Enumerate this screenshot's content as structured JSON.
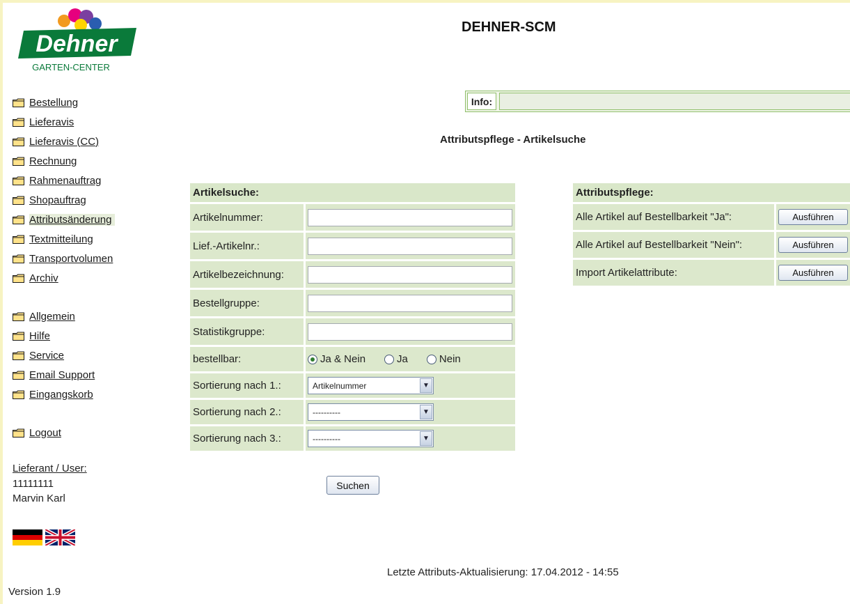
{
  "logo": {
    "brand": "Dehner",
    "subtitle": "GARTEN-CENTER"
  },
  "header": {
    "title": "DEHNER-SCM"
  },
  "nav": {
    "main": [
      "Bestellung",
      "Lieferavis",
      "Lieferavis (CC)",
      "Rechnung",
      "Rahmenauftrag",
      "Shopauftrag",
      "Attributsänderung",
      "Textmitteilung",
      "Transportvolumen",
      "Archiv"
    ],
    "secondary": [
      "Allgemein",
      "Hilfe",
      "Service",
      "Email Support",
      "Eingangskorb"
    ],
    "logout": "Logout",
    "active": "Attributsänderung"
  },
  "user": {
    "label": "Lieferant / User:",
    "id": "11111111",
    "name": "Marvin Karl"
  },
  "languages": [
    "de-flag-icon",
    "uk-flag-icon"
  ],
  "info": {
    "label": "Info:",
    "value": ""
  },
  "page": {
    "title": "Attributspflege - Artikelsuche"
  },
  "search": {
    "header": "Artikelsuche:",
    "fields": [
      {
        "label": "Artikelnummer:",
        "value": ""
      },
      {
        "label": "Lief.-Artikelnr.:",
        "value": ""
      },
      {
        "label": "Artikelbezeichnung:",
        "value": ""
      },
      {
        "label": "Bestellgruppe:",
        "value": ""
      },
      {
        "label": "Statistikgruppe:",
        "value": ""
      }
    ],
    "orderable": {
      "label": "bestellbar:",
      "options": [
        "Ja & Nein",
        "Ja",
        "Nein"
      ],
      "selected": "Ja & Nein"
    },
    "sort": [
      {
        "label": "Sortierung nach 1.:",
        "value": "Artikelnummer"
      },
      {
        "label": "Sortierung nach 2.:",
        "value": "----------"
      },
      {
        "label": "Sortierung nach 3.:",
        "value": "----------"
      }
    ],
    "submit": "Suchen"
  },
  "attributes": {
    "header": "Attributspflege:",
    "rows": [
      {
        "label": "Alle Artikel auf Bestellbarkeit \"Ja\":",
        "button": "Ausführen"
      },
      {
        "label": "Alle Artikel auf Bestellbarkeit \"Nein\":",
        "button": "Ausführen"
      },
      {
        "label": "Import Artikelattribute:",
        "button": "Ausführen"
      }
    ]
  },
  "footer": {
    "last_update": "Letzte Attributs-Aktualisierung: 17.04.2012 - 14:55",
    "version": "Version 1.9"
  },
  "colors": {
    "accent_green": "#0a7a3a",
    "panel_bg": "#dce8cc",
    "frame": "#f7f3c2"
  }
}
